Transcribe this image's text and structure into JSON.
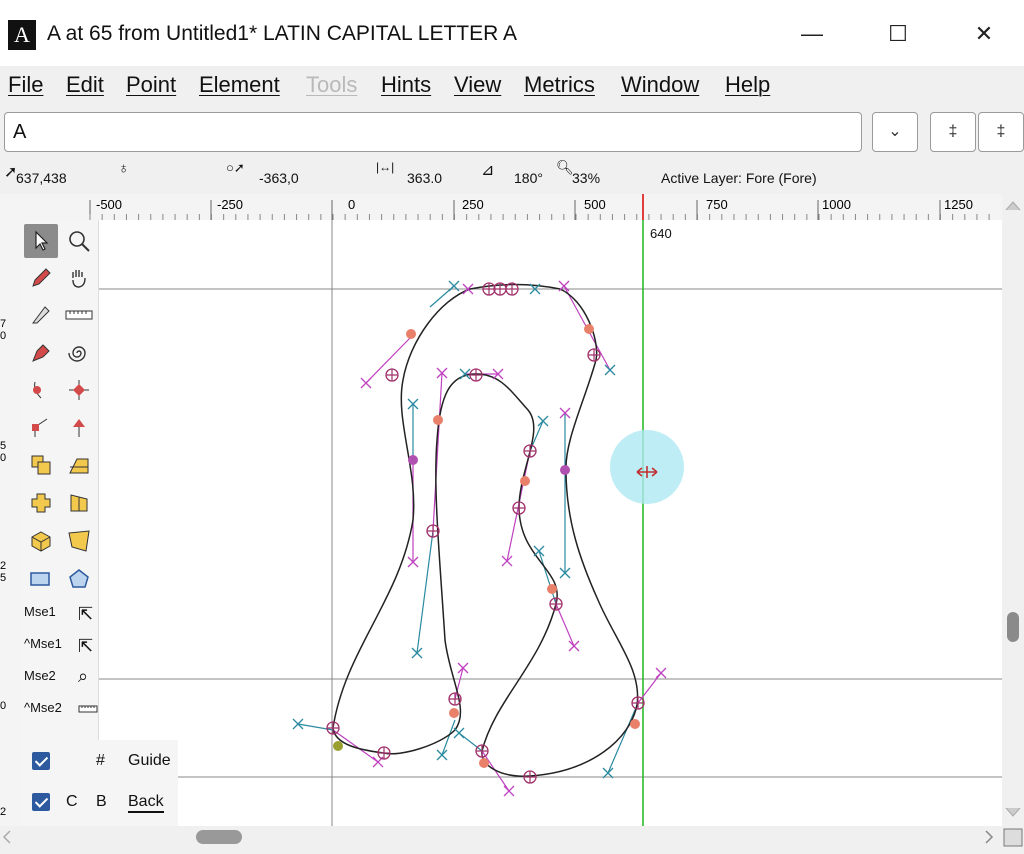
{
  "window": {
    "icon_letter": "A",
    "title": "A at 65 from Untitled1* LATIN CAPITAL LETTER A",
    "minimize": "—",
    "maximize": "☐",
    "close": "✕"
  },
  "menu": {
    "file": "File",
    "edit": "Edit",
    "point": "Point",
    "element": "Element",
    "tools": "Tools",
    "hints": "Hints",
    "view": "View",
    "metrics": "Metrics",
    "window": "Window",
    "help": "Help"
  },
  "glyph_field": {
    "value": "A"
  },
  "field_buttons": {
    "dropdown": "⌄",
    "up": "‡",
    "down": "‡"
  },
  "info": {
    "cursor_pos": "637,438",
    "offset": "-363,0",
    "distance": "363.0",
    "angle": "180°",
    "zoom": "33%",
    "active_layer": "Active Layer: Fore (Fore)"
  },
  "ruler": {
    "ticks": [
      "-500",
      "-250",
      "0",
      "250",
      "500",
      "750",
      "1000",
      "1250"
    ],
    "guide_label": "640",
    "left_labels": [
      "7",
      "0",
      "5",
      "0",
      "2",
      "5",
      "0",
      "2"
    ]
  },
  "palette": {
    "mse1": "Mse1",
    "cmse1": "^Mse1",
    "mse2": "Mse2",
    "cmse2": "^Mse2"
  },
  "layers": {
    "guide_hash": "#",
    "guide_label": "Guide",
    "back_c": "C",
    "back_b": "B",
    "back_label": "Back"
  },
  "colors": {
    "outline": "#222222",
    "guide_green": "#1fb81f",
    "handle_magenta": "#c040c0",
    "handle_teal": "#2a8aa0",
    "point_salmon": "#e8806a",
    "highlight_cyan": "#aee8f2"
  }
}
